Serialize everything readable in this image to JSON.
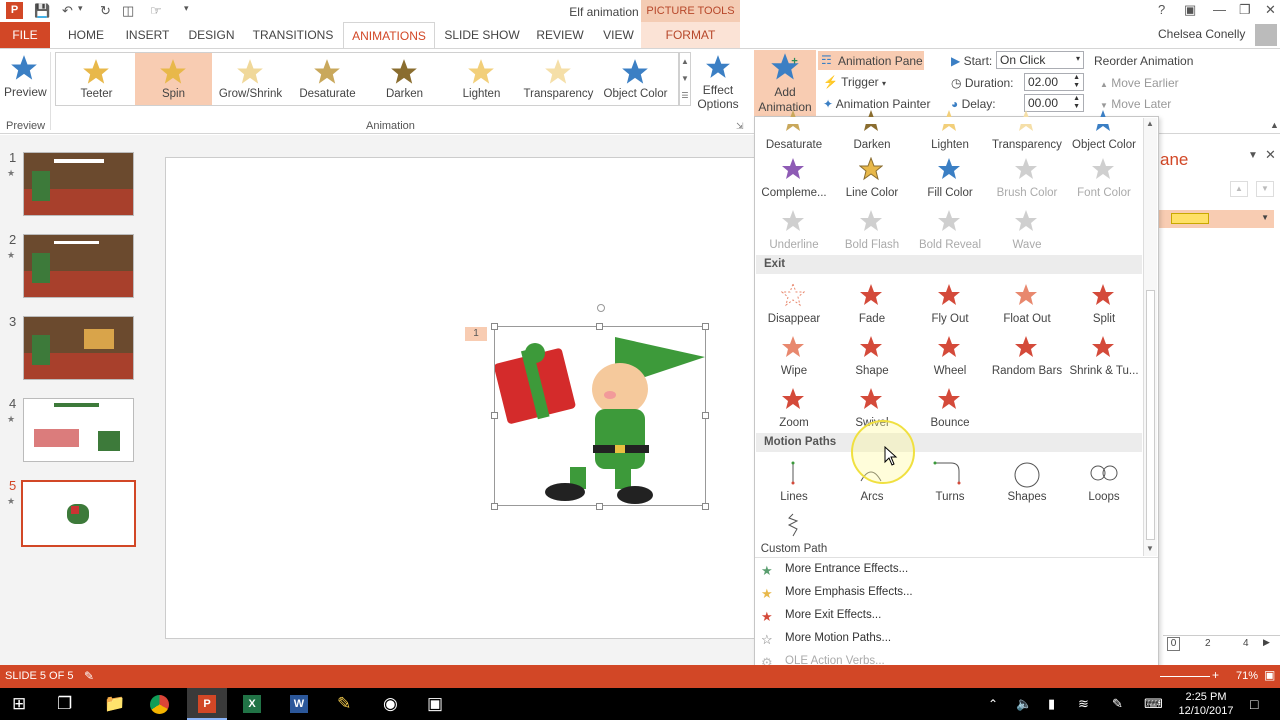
{
  "window": {
    "title": "Elf animation - PowerPoint",
    "picture_tools": "PICTURE TOOLS",
    "help": "?",
    "user": "Chelsea Conelly"
  },
  "tabs": [
    "FILE",
    "HOME",
    "INSERT",
    "DESIGN",
    "TRANSITIONS",
    "ANIMATIONS",
    "SLIDE SHOW",
    "REVIEW",
    "VIEW",
    "FORMAT"
  ],
  "ribbon": {
    "preview_label": "Preview",
    "preview_group": "Preview",
    "animation_group": "Animation",
    "gallery": [
      "Teeter",
      "Spin",
      "Grow/Shrink",
      "Desaturate",
      "Darken",
      "Lighten",
      "Transparency",
      "Object Color"
    ],
    "effect_options": "Effect Options",
    "add_animation": "Add Animation",
    "animation_pane": "Animation Pane",
    "trigger": "Trigger",
    "animation_painter": "Animation Painter",
    "start_label": "Start:",
    "start_value": "On Click",
    "duration_label": "Duration:",
    "duration_value": "02.00",
    "delay_label": "Delay:",
    "delay_value": "00.00",
    "reorder": "Reorder Animation",
    "move_earlier": "Move Earlier",
    "move_later": "Move Later"
  },
  "slides": [
    "1",
    "2",
    "3",
    "4",
    "5"
  ],
  "slide_badge": "1",
  "dropdown": {
    "row1": [
      "Desaturate",
      "Darken",
      "Lighten",
      "Transparency",
      "Object Color"
    ],
    "row2": [
      "Compleme...",
      "Line Color",
      "Fill Color",
      "Brush Color",
      "Font Color"
    ],
    "row3": [
      "Underline",
      "Bold Flash",
      "Bold Reveal",
      "Wave"
    ],
    "exit_header": "Exit",
    "exit1": [
      "Disappear",
      "Fade",
      "Fly Out",
      "Float Out",
      "Split"
    ],
    "exit2": [
      "Wipe",
      "Shape",
      "Wheel",
      "Random Bars",
      "Shrink & Tu..."
    ],
    "exit3": [
      "Zoom",
      "Swivel",
      "Bounce"
    ],
    "motion_header": "Motion Paths",
    "motion1": [
      "Lines",
      "Arcs",
      "Turns",
      "Shapes",
      "Loops"
    ],
    "motion2": [
      "Custom Path"
    ],
    "more_entrance": "More Entrance Effects...",
    "more_emphasis": "More Emphasis Effects...",
    "more_exit": "More Exit Effects...",
    "more_motion": "More Motion Paths...",
    "ole_verbs": "OLE Action Verbs..."
  },
  "pane": {
    "title_partial": "ane",
    "ruler": [
      "0",
      "2",
      "4"
    ]
  },
  "status": {
    "slide_of": "SLIDE 5 OF 5",
    "zoom": "71%"
  },
  "taskbar": {
    "time": "2:25 PM",
    "date": "12/10/2017"
  },
  "colors": {
    "accent": "#d24726",
    "selected": "#f8ccb2",
    "entrance": "#5a9e6f",
    "emphasis": "#e8b84a",
    "exit": "#d44a3a"
  }
}
